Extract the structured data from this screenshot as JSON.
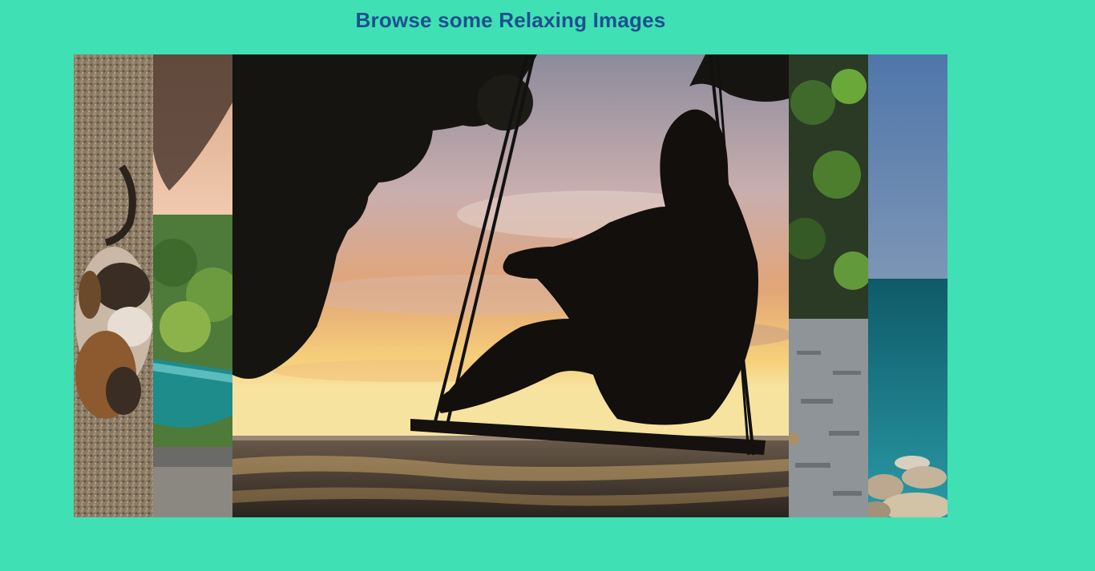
{
  "page": {
    "title": "Browse some Relaxing Images"
  },
  "colors": {
    "background": "#3fe0b4",
    "title": "#1f4f8f"
  },
  "gallery": {
    "active_index": 2,
    "panels": [
      {
        "subject": "cat-on-gravel-image"
      },
      {
        "subject": "hammock-garden-image"
      },
      {
        "subject": "swing-sunset-silhouette-image"
      },
      {
        "subject": "forest-path-image"
      },
      {
        "subject": "beach-pebbles-image"
      }
    ]
  }
}
